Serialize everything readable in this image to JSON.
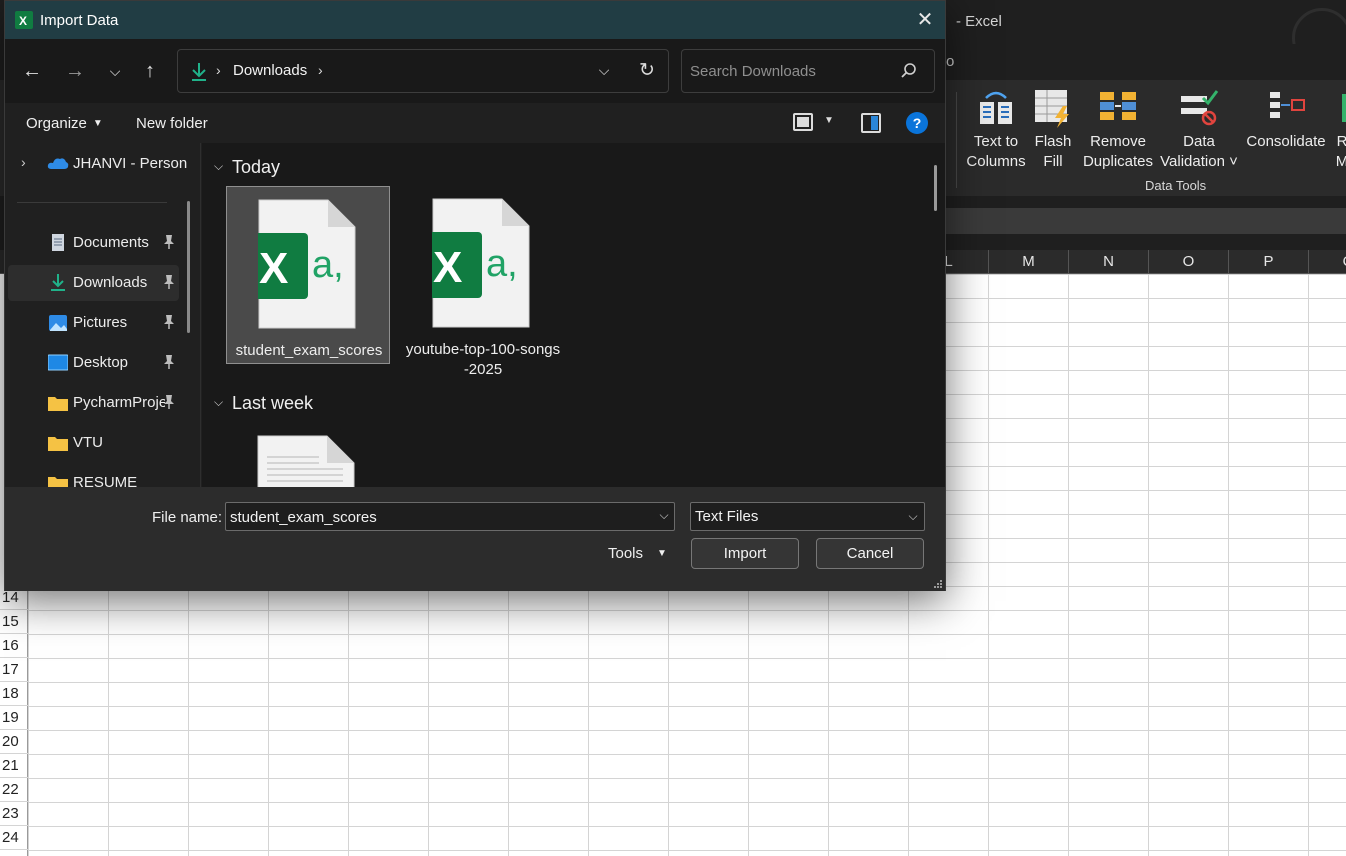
{
  "excel": {
    "title": "- Excel",
    "menu_fragment": "o",
    "ribbon": {
      "buttons": [
        {
          "line1": "Text to",
          "line2": "Columns"
        },
        {
          "line1": "Flash",
          "line2": "Fill"
        },
        {
          "line1": "Remove",
          "line2": "Duplicates"
        },
        {
          "line1": "Data",
          "line2": "Validation ˅"
        },
        {
          "line1": "Consolidate",
          "line2": ""
        },
        {
          "line1": "R",
          "line2": "M"
        }
      ],
      "group_label": "Data Tools"
    },
    "columns": [
      "L",
      "M",
      "N",
      "O",
      "P",
      "Q"
    ],
    "rows": [
      "14",
      "15",
      "16",
      "17",
      "18",
      "19",
      "20",
      "21",
      "22",
      "23",
      "24"
    ]
  },
  "dialog": {
    "title": "Import Data",
    "close_icon": "close-icon",
    "address": {
      "location": "Downloads"
    },
    "search": {
      "placeholder": "Search Downloads"
    },
    "commands": {
      "organize": "Organize",
      "new_folder": "New folder"
    },
    "sidebar": {
      "onedrive": "JHANVI - Person",
      "items": [
        {
          "label": "Documents",
          "icon": "documents-icon",
          "pinned": true
        },
        {
          "label": "Downloads",
          "icon": "downloads-icon",
          "pinned": true,
          "selected": true
        },
        {
          "label": "Pictures",
          "icon": "pictures-icon",
          "pinned": true
        },
        {
          "label": "Desktop",
          "icon": "desktop-icon",
          "pinned": true
        },
        {
          "label": "PycharmProje",
          "icon": "folder-icon",
          "pinned": true
        },
        {
          "label": "VTU",
          "icon": "folder-icon",
          "pinned": false
        },
        {
          "label": "RESUME",
          "icon": "folder-icon",
          "pinned": false
        }
      ]
    },
    "groups": [
      {
        "title": "Today",
        "files": [
          "student_exam_scores",
          "youtube-top-100-songs-2025"
        ]
      },
      {
        "title": "Last week",
        "files": [
          ""
        ]
      }
    ],
    "footer": {
      "file_name_label": "File name:",
      "file_name_value": "student_exam_scores",
      "file_type": "Text Files",
      "tools": "Tools",
      "import": "Import",
      "cancel": "Cancel"
    }
  },
  "colors": {
    "title_bar": "#213d44",
    "excel_green": "#107c41",
    "excel_glyph": "#21a366",
    "help_blue": "#0a74da",
    "download_arrow": "#20b28a"
  }
}
